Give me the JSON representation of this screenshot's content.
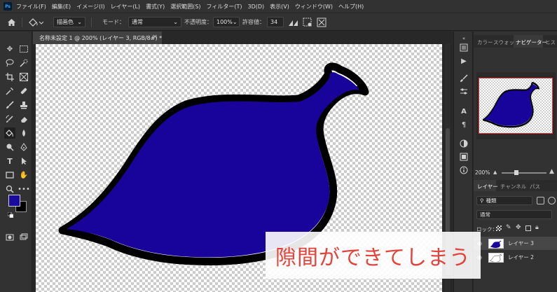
{
  "app": {
    "logo": "Ps"
  },
  "menu": [
    "ファイル(F)",
    "編集(E)",
    "イメージ(I)",
    "レイヤー(L)",
    "書式(Y)",
    "選択範囲(S)",
    "フィルター(T)",
    "3D(D)",
    "表示(V)",
    "ウィンドウ(W)",
    "ヘルプ(H)"
  ],
  "options": {
    "fill_source": "描画色",
    "mode_label": "モード：",
    "mode_value": "通常",
    "opacity_label": "不透明度：",
    "opacity_value": "100%",
    "tolerance_label": "許容値：",
    "tolerance_value": "34"
  },
  "document": {
    "tab_title": "名称未設定 1 @ 200% (レイヤー 3, RGB/8#) *",
    "close_glyph": "×"
  },
  "colors": {
    "foreground": "#1a0a9e",
    "background": "#000000",
    "shape_fill": "#18049a",
    "annotation_text": "#e4433b"
  },
  "panels": {
    "top_tabs": [
      "カラー",
      "スウォッチ",
      "ナビゲーター",
      "ヒス"
    ],
    "active_top_tab": "ナビゲーター",
    "zoom": "200%",
    "layer_tabs": [
      "レイヤー",
      "チャンネル",
      "パス"
    ],
    "active_layer_tab": "レイヤー",
    "filter_kind": "種類",
    "blend_mode": "通常",
    "lock_label": "ロック：",
    "layers": [
      {
        "name": "レイヤー 3",
        "selected": true
      },
      {
        "name": "レイヤー 2",
        "selected": false
      }
    ]
  },
  "annotation": {
    "text": "隙間ができてしまう"
  }
}
